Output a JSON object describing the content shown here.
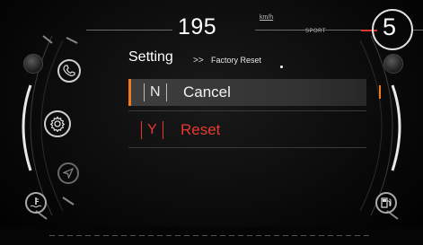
{
  "header": {
    "speed": "195",
    "speed_unit": "km/h",
    "mode": "SPORT",
    "gear": "5"
  },
  "menu": {
    "title": "Setting",
    "separator": ">>",
    "subtitle": "Factory Reset",
    "options": [
      {
        "key": "N",
        "label": "Cancel",
        "selected": true
      },
      {
        "key": "Y",
        "label": "Reset",
        "selected": false
      }
    ]
  },
  "left_icons": [
    "phone-icon",
    "settings-icon",
    "navigation-icon",
    "coolant-temperature-icon"
  ],
  "right_icons": [
    "fuel-pump-icon"
  ],
  "colors": {
    "accent_orange": "#f07a1e",
    "accent_red": "#e53a2f",
    "gear_accent": "#d93a2b"
  }
}
